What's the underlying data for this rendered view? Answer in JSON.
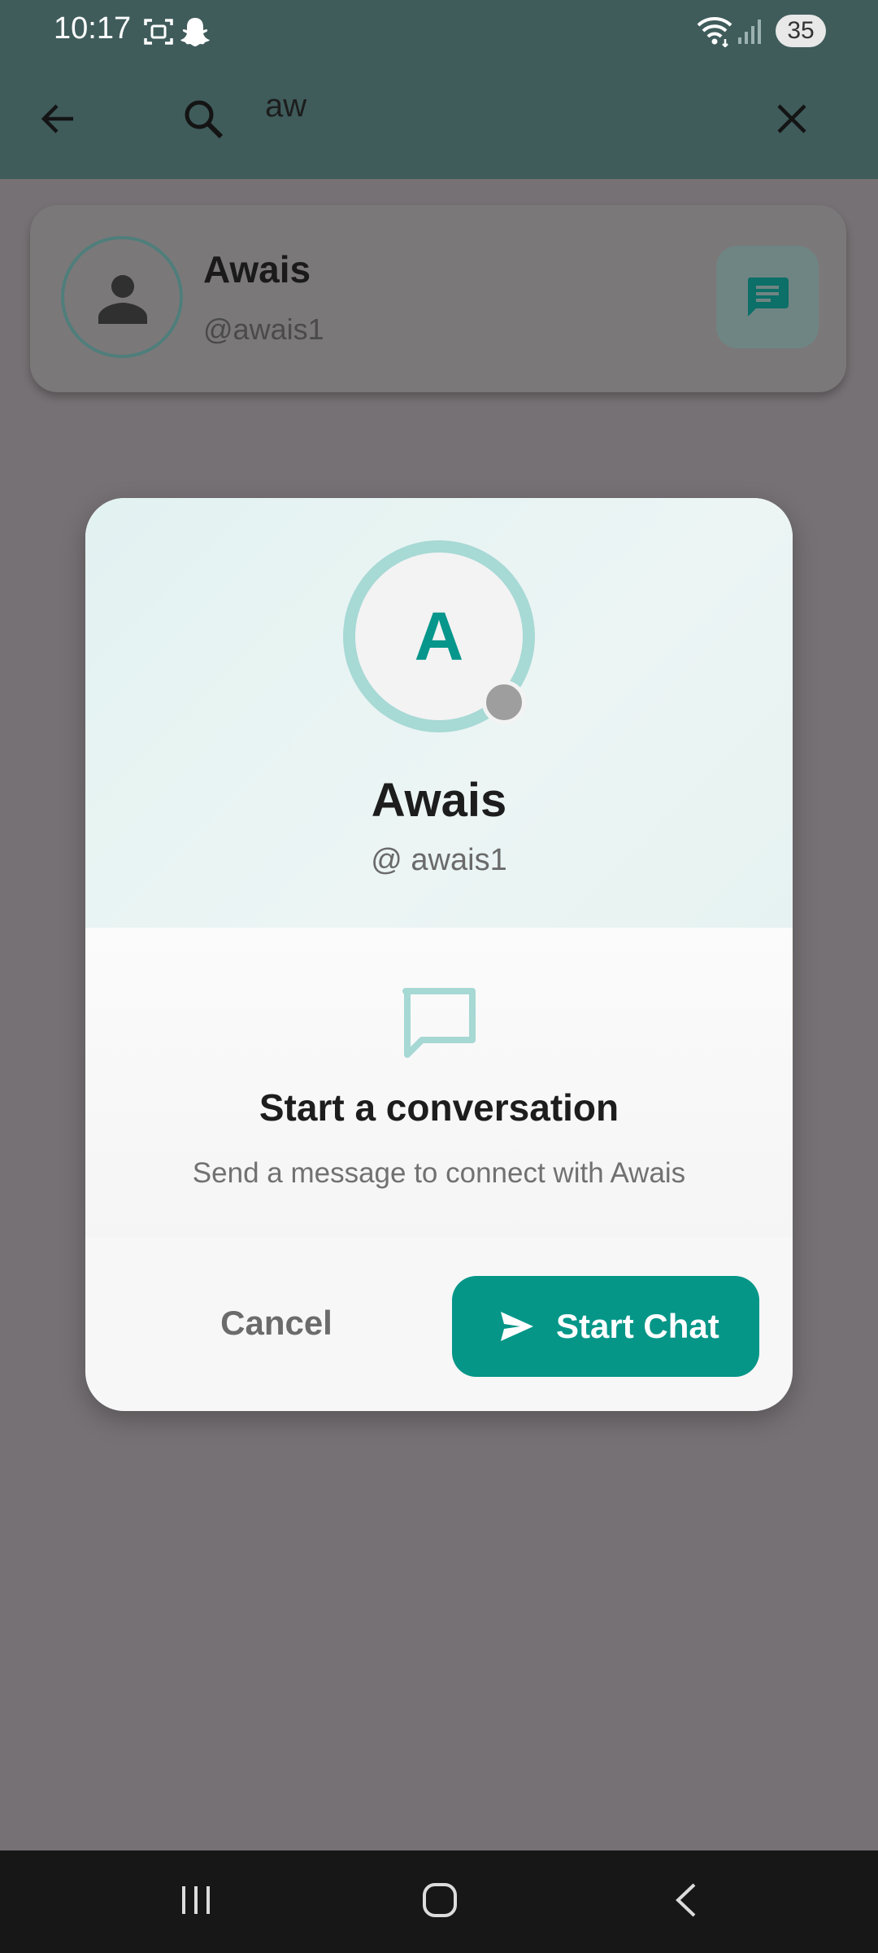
{
  "status_bar": {
    "time": "10:17",
    "battery": "35",
    "icons": [
      "screenshot-icon",
      "snapchat-ghost-icon",
      "wifi-icon",
      "signal-icon"
    ]
  },
  "app_bar": {
    "search_query": "aw",
    "icons": [
      "back-arrow-icon",
      "search-icon",
      "clear-icon"
    ]
  },
  "result": {
    "name": "Awais",
    "handle": "@awais1",
    "icons": [
      "person-icon",
      "chat-message-icon"
    ]
  },
  "dialog": {
    "avatar_initial": "A",
    "name": "Awais",
    "handle": "@ awais1",
    "prompt_title": "Start a conversation",
    "prompt_subtitle": "Send a message to connect with Awais",
    "cancel_label": "Cancel",
    "start_label": "Start Chat",
    "colors": {
      "accent": "#059688",
      "ring": "#a7d9d5",
      "offline_dot": "#9e9e9e"
    }
  },
  "nav_bar": {
    "icons": [
      "recent-apps-icon",
      "home-icon",
      "back-icon"
    ]
  }
}
